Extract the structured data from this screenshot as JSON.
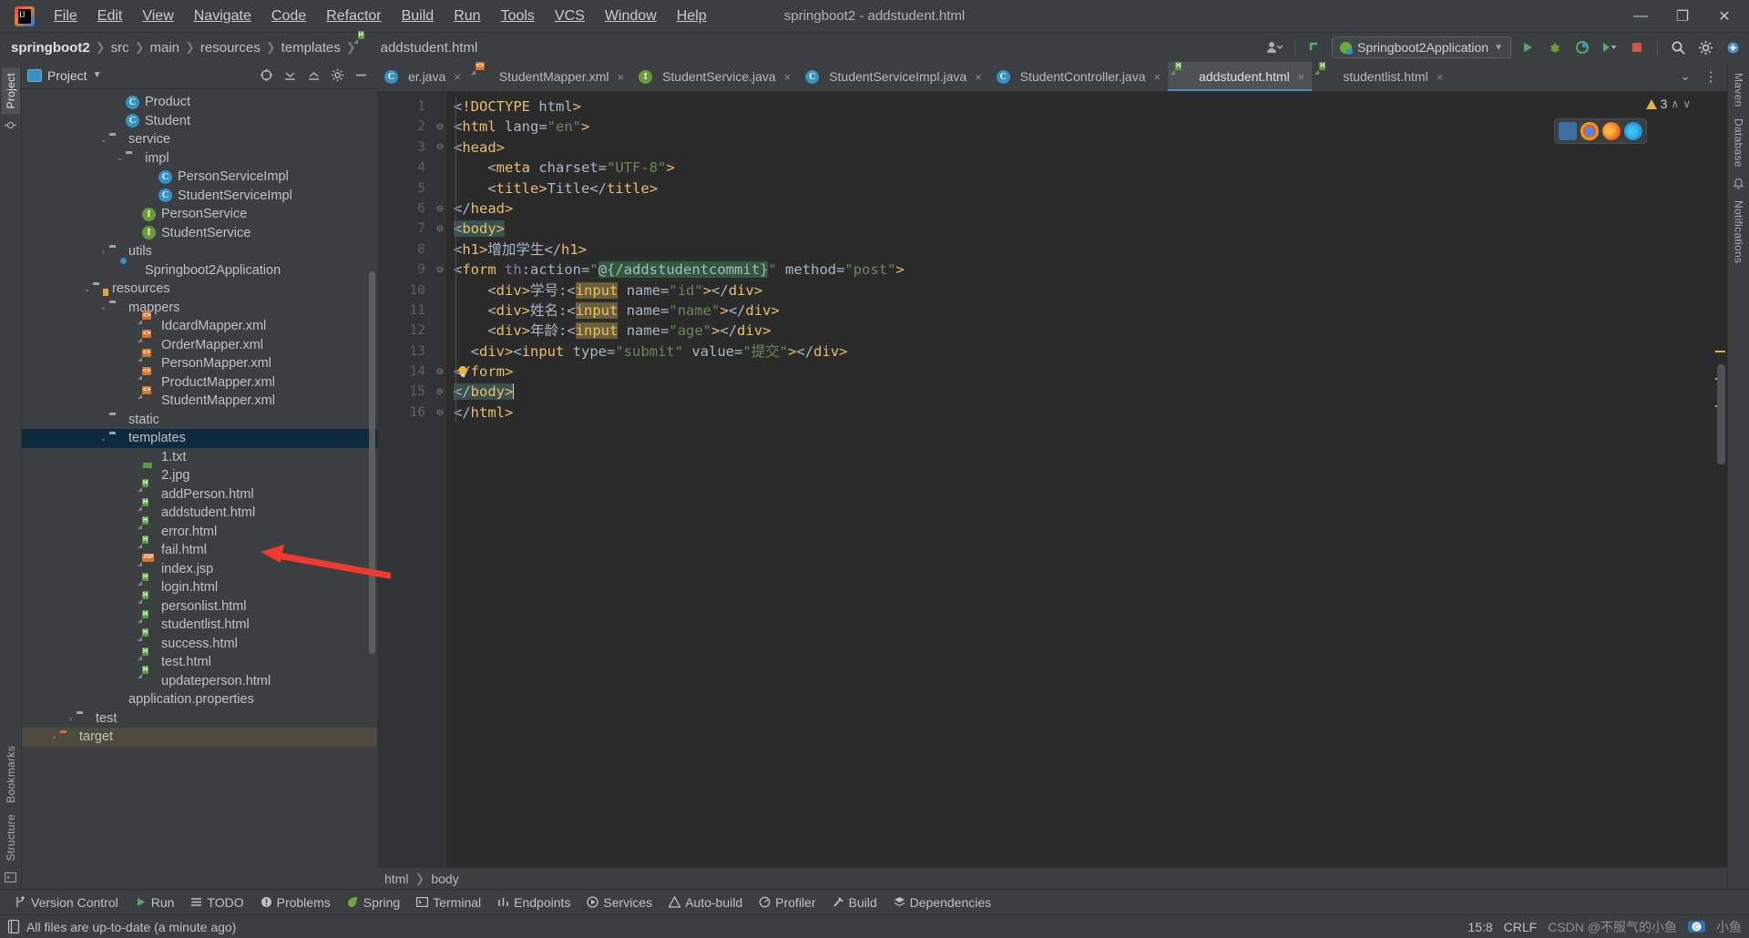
{
  "window": {
    "title": "springboot2 - addstudent.html"
  },
  "menu": {
    "items": [
      "File",
      "Edit",
      "View",
      "Navigate",
      "Code",
      "Refactor",
      "Build",
      "Run",
      "Tools",
      "VCS",
      "Window",
      "Help"
    ]
  },
  "window_controls": {
    "minimize": "—",
    "maximize": "❐",
    "close": "✕"
  },
  "breadcrumb": {
    "items": [
      "springboot2",
      "src",
      "main",
      "resources",
      "templates",
      "addstudent.html"
    ]
  },
  "navbar": {
    "run_config": "Springboot2Application",
    "icons": {
      "user": "user-icon",
      "updates": "vcs-update-icon",
      "run": "run-icon",
      "debug": "debug-icon",
      "coverage": "run-with-coverage-icon",
      "more_run": "more-run-options-icon",
      "stop": "stop-icon",
      "search": "search-everywhere-icon",
      "settings": "settings-icon",
      "ai": "ai-assistant-icon"
    }
  },
  "left_strip": {
    "tabs": [
      "Project",
      "Bookmarks",
      "Structure"
    ]
  },
  "right_strip": {
    "tabs": [
      "Maven",
      "Database",
      "Notifications"
    ]
  },
  "project_panel": {
    "title": "Project",
    "header_icons": [
      "select-opened-file-icon",
      "expand-all-icon",
      "collapse-all-icon",
      "settings-icon",
      "hide-icon"
    ],
    "tree": [
      {
        "label": "Product",
        "indent": 6,
        "icon": "class-icon",
        "arrow": "",
        "state": "none"
      },
      {
        "label": "Student",
        "indent": 6,
        "icon": "class-icon",
        "arrow": "",
        "state": "none"
      },
      {
        "label": "service",
        "indent": 5,
        "icon": "folder-icon",
        "arrow": "v",
        "state": "none"
      },
      {
        "label": "impl",
        "indent": 6,
        "icon": "folder-icon",
        "arrow": "v",
        "state": "none"
      },
      {
        "label": "PersonServiceImpl",
        "indent": 8,
        "icon": "class-icon",
        "arrow": "",
        "state": "none"
      },
      {
        "label": "StudentServiceImpl",
        "indent": 8,
        "icon": "class-icon",
        "arrow": "",
        "state": "none"
      },
      {
        "label": "PersonService",
        "indent": 7,
        "icon": "interface-icon",
        "arrow": "",
        "state": "none"
      },
      {
        "label": "StudentService",
        "indent": 7,
        "icon": "interface-icon",
        "arrow": "",
        "state": "none"
      },
      {
        "label": "utils",
        "indent": 5,
        "icon": "folder-icon",
        "arrow": ">",
        "state": "none"
      },
      {
        "label": "Springboot2Application",
        "indent": 6,
        "icon": "spring-icon",
        "arrow": "",
        "state": "none"
      },
      {
        "label": "resources",
        "indent": 4,
        "icon": "resources-folder-icon",
        "arrow": "v",
        "state": "none"
      },
      {
        "label": "mappers",
        "indent": 5,
        "icon": "folder-icon",
        "arrow": "v",
        "state": "none"
      },
      {
        "label": "IdcardMapper.xml",
        "indent": 7,
        "icon": "xml-file-icon",
        "arrow": "",
        "state": "none"
      },
      {
        "label": "OrderMapper.xml",
        "indent": 7,
        "icon": "xml-file-icon",
        "arrow": "",
        "state": "none"
      },
      {
        "label": "PersonMapper.xml",
        "indent": 7,
        "icon": "xml-file-icon",
        "arrow": "",
        "state": "none"
      },
      {
        "label": "ProductMapper.xml",
        "indent": 7,
        "icon": "xml-file-icon",
        "arrow": "",
        "state": "none"
      },
      {
        "label": "StudentMapper.xml",
        "indent": 7,
        "icon": "xml-file-icon",
        "arrow": "",
        "state": "none"
      },
      {
        "label": "static",
        "indent": 5,
        "icon": "folder-icon",
        "arrow": "",
        "state": "none"
      },
      {
        "label": "templates",
        "indent": 5,
        "icon": "folder-icon",
        "arrow": "v",
        "state": "selected"
      },
      {
        "label": "1.txt",
        "indent": 7,
        "icon": "txt-file-icon",
        "arrow": "",
        "state": "none"
      },
      {
        "label": "2.jpg",
        "indent": 7,
        "icon": "image-file-icon",
        "arrow": "",
        "state": "none"
      },
      {
        "label": "addPerson.html",
        "indent": 7,
        "icon": "html-file-icon",
        "arrow": "",
        "state": "none"
      },
      {
        "label": "addstudent.html",
        "indent": 7,
        "icon": "html-file-icon",
        "arrow": "",
        "state": "none"
      },
      {
        "label": "error.html",
        "indent": 7,
        "icon": "html-file-icon",
        "arrow": "",
        "state": "none"
      },
      {
        "label": "fail.html",
        "indent": 7,
        "icon": "html-file-icon",
        "arrow": "",
        "state": "none"
      },
      {
        "label": "index.jsp",
        "indent": 7,
        "icon": "jsp-file-icon",
        "arrow": "",
        "state": "none"
      },
      {
        "label": "login.html",
        "indent": 7,
        "icon": "html-file-icon",
        "arrow": "",
        "state": "none"
      },
      {
        "label": "personlist.html",
        "indent": 7,
        "icon": "html-file-icon",
        "arrow": "",
        "state": "none"
      },
      {
        "label": "studentlist.html",
        "indent": 7,
        "icon": "html-file-icon",
        "arrow": "",
        "state": "none"
      },
      {
        "label": "success.html",
        "indent": 7,
        "icon": "html-file-icon",
        "arrow": "",
        "state": "none"
      },
      {
        "label": "test.html",
        "indent": 7,
        "icon": "html-file-icon",
        "arrow": "",
        "state": "none"
      },
      {
        "label": "updateperson.html",
        "indent": 7,
        "icon": "html-file-icon",
        "arrow": "",
        "state": "none"
      },
      {
        "label": "application.properties",
        "indent": 5,
        "icon": "properties-file-icon",
        "arrow": "",
        "state": "none"
      },
      {
        "label": "test",
        "indent": 3,
        "icon": "folder-icon",
        "arrow": ">",
        "state": "none"
      },
      {
        "label": "target",
        "indent": 2,
        "icon": "target-folder-icon",
        "arrow": ">",
        "state": "highlight"
      }
    ]
  },
  "editor_tabs": {
    "tabs": [
      {
        "label": "er.java",
        "icon": "class-icon",
        "active": false
      },
      {
        "label": "StudentMapper.xml",
        "icon": "xml-file-icon",
        "active": false
      },
      {
        "label": "StudentService.java",
        "icon": "interface-icon",
        "active": false
      },
      {
        "label": "StudentServiceImpl.java",
        "icon": "class-icon",
        "active": false
      },
      {
        "label": "StudentController.java",
        "icon": "class-icon",
        "active": false
      },
      {
        "label": "addstudent.html",
        "icon": "html-file-icon",
        "active": true
      },
      {
        "label": "studentlist.html",
        "icon": "html-file-icon",
        "active": false
      }
    ],
    "close_glyph": "×",
    "more_glyph": "⋮",
    "chevron_glyph": "⌄"
  },
  "inspection": {
    "warning_count": "3",
    "up_glyph": "∧",
    "down_glyph": "∨"
  },
  "editor": {
    "line_numbers": [
      "1",
      "2",
      "3",
      "4",
      "5",
      "6",
      "7",
      "8",
      "9",
      "10",
      "11",
      "12",
      "13",
      "14",
      "15",
      "16"
    ],
    "lines": [
      "<!DOCTYPE html>",
      "<html lang=\"en\">",
      "<head>",
      "    <meta charset=\"UTF-8\">",
      "    <title>Title</title>",
      "</head>",
      "<body>",
      "<h1>增加学生</h1>",
      "<form th:action=\"@{/addstudentcommit}\" method=\"post\">",
      "    <div>学号:<input name=\"id\"></div>",
      "    <div>姓名:<input name=\"name\"></div>",
      "    <div>年龄:<input name=\"age\"></div>",
      "  <div><input type=\"submit\" value=\"提交\"></div>",
      "</form>",
      "</body>",
      "</html>"
    ]
  },
  "editor_breadcrumb": {
    "items": [
      "html",
      "body"
    ]
  },
  "bottom_bar": {
    "items": [
      {
        "label": "Version Control",
        "icon": "vcs-branch-icon"
      },
      {
        "label": "Run",
        "icon": "run-icon"
      },
      {
        "label": "TODO",
        "icon": "todo-icon"
      },
      {
        "label": "Problems",
        "icon": "problems-icon"
      },
      {
        "label": "Spring",
        "icon": "spring-leaf-icon"
      },
      {
        "label": "Terminal",
        "icon": "terminal-icon"
      },
      {
        "label": "Endpoints",
        "icon": "endpoints-icon"
      },
      {
        "label": "Services",
        "icon": "services-icon"
      },
      {
        "label": "Auto-build",
        "icon": "auto-build-icon"
      },
      {
        "label": "Profiler",
        "icon": "profiler-icon"
      },
      {
        "label": "Build",
        "icon": "build-hammer-icon"
      },
      {
        "label": "Dependencies",
        "icon": "dependencies-icon"
      }
    ]
  },
  "status_bar": {
    "message": "All files are up-to-date (a minute ago)",
    "caret_position": "15:8",
    "line_separator": "CRLF",
    "watermark": "CSDN @不服气的小鱼",
    "watermark_tail": "小鱼"
  },
  "colors": {
    "accent_blue": "#4a88c7",
    "selection_blue": "#0d293e",
    "warning_yellow": "#e8b339",
    "annotation_red": "#ef3b2d",
    "editor_bg": "#2b2b2b",
    "panel_bg": "#3c3f41"
  }
}
